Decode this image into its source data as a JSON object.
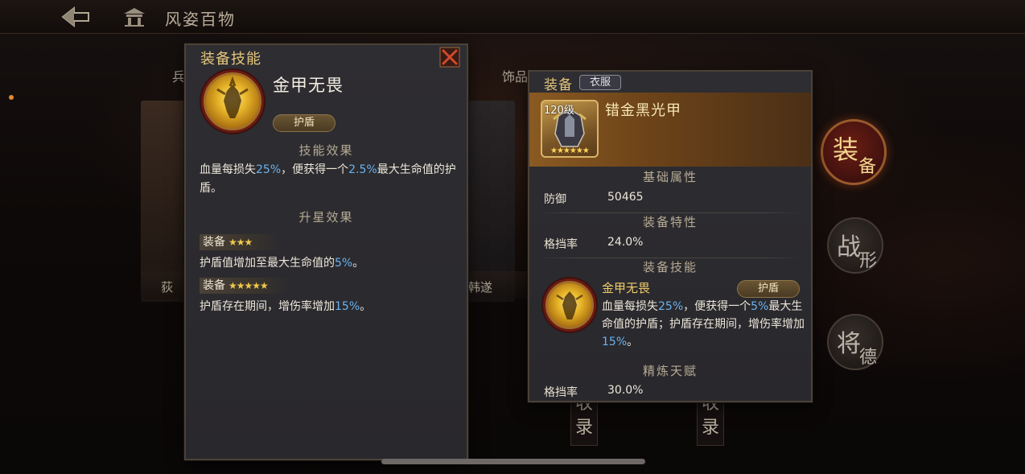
{
  "header": {
    "title": "风姿百物"
  },
  "background": {
    "tabs": [
      "兵",
      "饰品"
    ],
    "names": [
      "荻",
      "韩遂"
    ],
    "pillars": [
      "收录",
      "收录"
    ]
  },
  "side_nav": [
    {
      "line1": "装",
      "line2": "备",
      "active": true
    },
    {
      "line1": "战",
      "line2": "形",
      "active": false
    },
    {
      "line1": "将",
      "line2": "德",
      "active": false
    }
  ],
  "skill_panel": {
    "title": "装备技能",
    "skill_name": "金甲无畏",
    "tag": "护盾",
    "effect_heading": "技能效果",
    "effect_parts": {
      "p1": "血量每损失",
      "v1": "25%",
      "p2": "，便获得一个",
      "v2": "2.5%",
      "p3": "最大生命值的护盾。"
    },
    "star_heading": "升星效果",
    "star_effects": [
      {
        "label": "装备",
        "stars": "★★★",
        "text": "护盾值增加至最大生命值的",
        "value": "5%",
        "suffix": "。"
      },
      {
        "label": "装备",
        "stars": "★★★★★",
        "text": "护盾存在期间，增伤率增加",
        "value": "15%",
        "suffix": "。"
      }
    ]
  },
  "equip_panel": {
    "heading": "装备",
    "badge": "衣服",
    "item_level": "120级",
    "item_stars": "★★★★★★",
    "item_name": "错金黑光甲",
    "base_heading": "基础属性",
    "base_stats": [
      {
        "label": "防御",
        "value": "50465"
      }
    ],
    "trait_heading": "装备特性",
    "trait_stats": [
      {
        "label": "格挡率",
        "value": "24.0%"
      }
    ],
    "skill_heading": "装备技能",
    "skill": {
      "name": "金甲无畏",
      "tag": "护盾",
      "parts": {
        "p1": "血量每损失",
        "v1": "25%",
        "p2": "，便获得一个",
        "v2": "5%",
        "p3": "最大生命值的护盾；护盾存在期间，增伤率增加",
        "v3": "15%",
        "p4": "。"
      }
    },
    "refine_heading": "精炼天赋",
    "refine_stats": [
      {
        "label": "格挡率",
        "value": "30.0%"
      }
    ]
  },
  "colors": {
    "accent_gold": "#e5c77c",
    "highlight_blue": "#6ab3f0",
    "panel_bg": "#2e2d31"
  }
}
